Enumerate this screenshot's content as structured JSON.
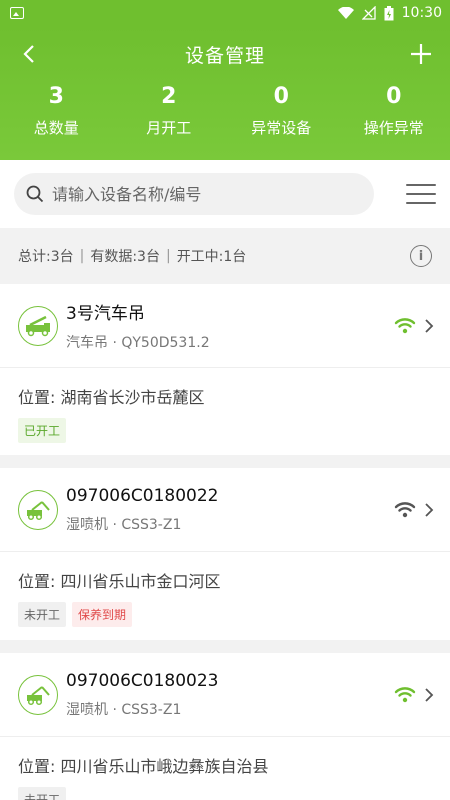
{
  "status_bar": {
    "time": "10:30"
  },
  "header": {
    "title": "设备管理"
  },
  "stats": [
    {
      "value": "3",
      "label": "总数量"
    },
    {
      "value": "2",
      "label": "月开工"
    },
    {
      "value": "0",
      "label": "异常设备"
    },
    {
      "value": "0",
      "label": "操作异常"
    }
  ],
  "search": {
    "placeholder": "请输入设备名称/编号"
  },
  "summary": {
    "total": "总计:3台",
    "with_data": "有数据:3台",
    "working": "开工中:1台"
  },
  "devices": [
    {
      "name": "3号汽车吊",
      "sub": "汽车吊 · QY50D531.2",
      "location": "位置: 湖南省长沙市岳麓区",
      "signal": "wifi-active",
      "tags": [
        {
          "label": "已开工",
          "type": "on"
        }
      ]
    },
    {
      "name": "097006C0180022",
      "sub": "湿喷机 · CSS3-Z1",
      "location": "位置: 四川省乐山市金口河区",
      "signal": "wifi-inactive",
      "tags": [
        {
          "label": "未开工",
          "type": "off"
        },
        {
          "label": "保养到期",
          "type": "warn"
        }
      ]
    },
    {
      "name": "097006C0180023",
      "sub": "湿喷机 · CSS3-Z1",
      "location": "位置: 四川省乐山市峨边彝族自治县",
      "signal": "wifi-active",
      "tags": [
        {
          "label": "未开工",
          "type": "off"
        }
      ]
    }
  ],
  "colors": {
    "brand_green": "#6fbf2f",
    "signal_active": "#6fbf2f",
    "signal_inactive": "#555555",
    "warn_red": "#e04a4a"
  }
}
